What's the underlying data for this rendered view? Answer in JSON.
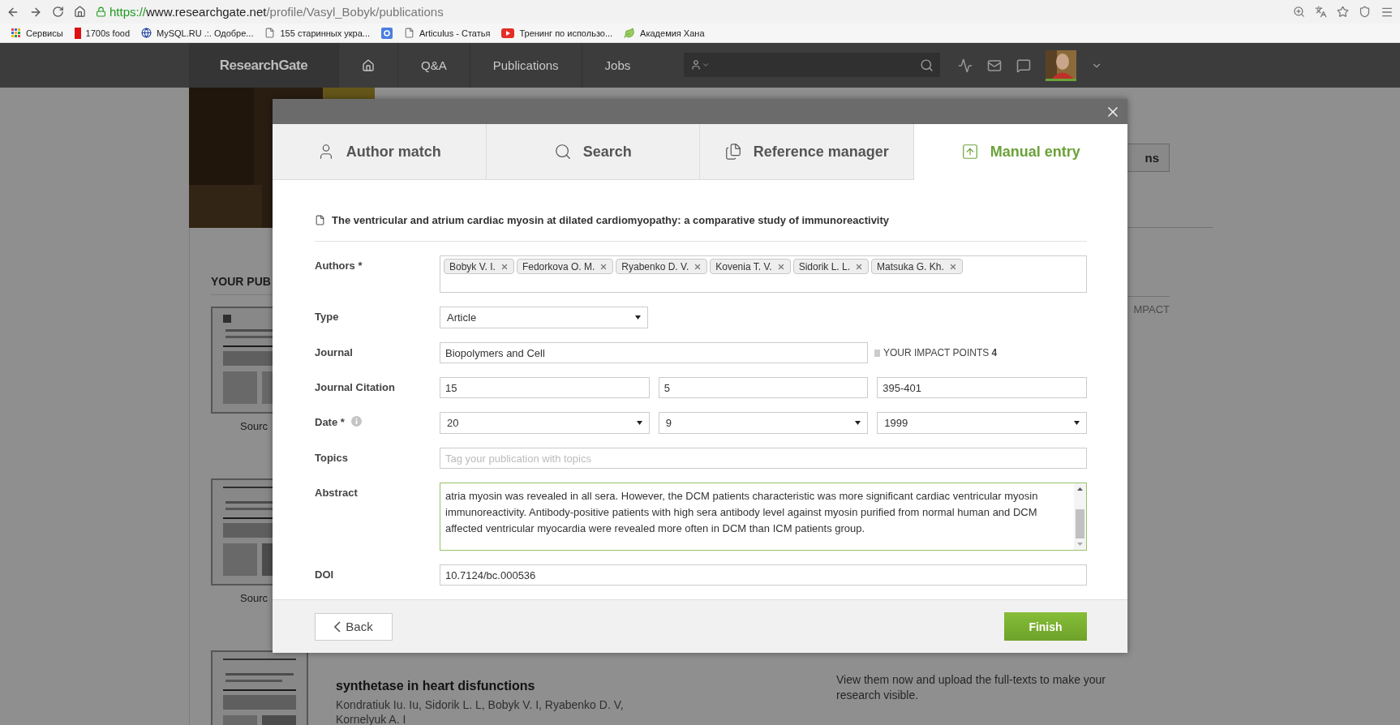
{
  "browser": {
    "url": {
      "scheme": "https://",
      "host": "www.researchgate.net",
      "path": "/profile/Vasyl_Bobyk/publications"
    },
    "bookmarks": [
      {
        "label": "Сервисы",
        "kind": "apps"
      },
      {
        "label": "1700s food",
        "kind": "red"
      },
      {
        "label": "MySQL.RU .:. Одобре...",
        "kind": "globe"
      },
      {
        "label": "155 старинных укра...",
        "kind": "page"
      },
      {
        "kind": "google"
      },
      {
        "label": "Articulus - Статья",
        "kind": "page"
      },
      {
        "label": "Тренинг по использо...",
        "kind": "video"
      },
      {
        "label": "Академия Хана",
        "kind": "leaf"
      }
    ]
  },
  "header": {
    "logo": "ResearchGate",
    "nav": [
      {
        "label": "Q&A"
      },
      {
        "label": "Publications"
      },
      {
        "label": "Jobs"
      }
    ]
  },
  "background": {
    "section_heading": "YOUR PUB",
    "source_labels": [
      "Sourc",
      "Sourc"
    ],
    "impact_fragment": "MPACT",
    "button_fragment": "ns",
    "publication_title": "synthetase in heart disfunctions",
    "publication_authors": "Kondratiuk Iu. Iu, Sidorik L. L, Bobyk V. I, Ryabenko D. V, Kornelyuk A. I",
    "promo_text": "View them now and upload the full-texts to make your research visible."
  },
  "dialog": {
    "tabs": [
      {
        "label": "Author match",
        "kind": "user",
        "selected": false
      },
      {
        "label": "Search",
        "kind": "search",
        "selected": false
      },
      {
        "label": "Reference manager",
        "kind": "references",
        "selected": false
      },
      {
        "label": "Manual entry",
        "kind": "upload",
        "selected": true
      }
    ],
    "title": "The ventricular and atrium cardiac myosin at dilated cardiomyopathy: a comparative study of immunoreactivity",
    "fields": [
      {
        "label": "Authors *",
        "kind": "tags",
        "tags": [
          "Bobyk V. I.",
          "Fedorkova O. M.",
          "Ryabenko D. V.",
          "Kovenia T. V.",
          "Sidorik L. L.",
          "Matsuka G. Kh."
        ]
      },
      {
        "label": "Type",
        "kind": "select",
        "value": "Article"
      },
      {
        "label": "Journal",
        "kind": "text",
        "value": "Biopolymers and Cell",
        "note": "YOUR IMPACT POINTS **4**"
      },
      {
        "label": "Journal Citation",
        "kind": "triple",
        "values": [
          "15",
          "5",
          "395-401"
        ]
      },
      {
        "label": "Date *",
        "kind": "triple_select",
        "values": [
          "20",
          "9",
          "1999"
        ],
        "info": true
      },
      {
        "label": "Topics",
        "kind": "text",
        "placeholder": "Tag your publication with topics"
      },
      {
        "label": "Abstract",
        "kind": "textarea",
        "focused": true,
        "value": "atria myosin was revealed in all sera. However, the DCM patients characteristic was more significant cardiac ventricular myosin immunoreactivity. Antibody-positive patients with high sera antibody level against myosin purified from normal human and DCM affected ventricular myocardia were revealed more often in DCM than ICM patients group."
      },
      {
        "label": "DOI",
        "kind": "text",
        "value": "10.7124/bc.000536"
      }
    ],
    "back": "Back",
    "finish": "Finish"
  }
}
